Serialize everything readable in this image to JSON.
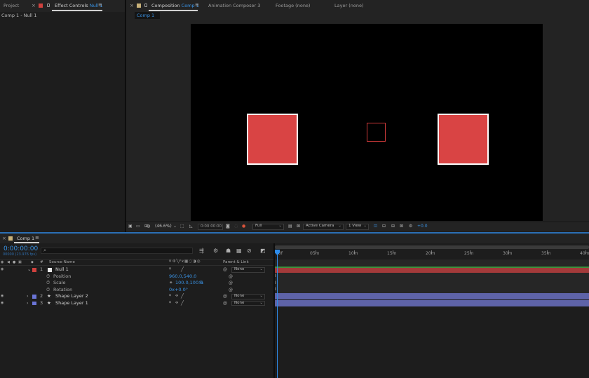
{
  "top_tabs": {
    "project": "Project",
    "effect_controls_prefix": "Effect Controls",
    "effect_controls_target": "Null 1",
    "composition_prefix": "Composition",
    "composition_target": "Comp 1",
    "animation_composer": "Animation Composer 3",
    "footage": "Footage (none)",
    "layer": "Layer (none)"
  },
  "effect_controls": {
    "breadcrumb": "Comp 1 - Null 1"
  },
  "composition": {
    "sub_tab": "Comp 1"
  },
  "viewer_toolbar": {
    "zoom": "(46.6%)",
    "timecode": "0:00:00:00",
    "resolution": "Full",
    "camera": "Active Camera",
    "view": "1 View",
    "exposure": "+0.0"
  },
  "timeline": {
    "tab": "Comp 1",
    "timecode": "0:00:00:00",
    "frame_info": "00000 (23.976 fps)",
    "search_placeholder": "",
    "headers": {
      "num": "#",
      "source_name": "Source Name",
      "parent_link": "Parent & Link"
    },
    "layers": [
      {
        "num": "1",
        "name": "Null 1",
        "label_color": "#d0413e",
        "parent": "None"
      },
      {
        "num": "2",
        "name": "Shape Layer 2",
        "label_color": "#6a74d6",
        "parent": "None"
      },
      {
        "num": "3",
        "name": "Shape Layer 1",
        "label_color": "#6a74d6",
        "parent": "None"
      }
    ],
    "properties": [
      {
        "name": "Position",
        "value": "960.0,540.0"
      },
      {
        "name": "Scale",
        "value": "100.0,100.0",
        "unit": "%"
      },
      {
        "name": "Rotation",
        "value": "0x+0.0°"
      }
    ],
    "ruler": [
      "0f",
      "05m",
      "10m",
      "15m",
      "20m",
      "25m",
      "30m",
      "35m",
      "40m"
    ]
  },
  "colors": {
    "accent": "#3a93e5",
    "shape_fill": "#d94444",
    "null_bar": "#a33a3a",
    "null_bar_top": "#3f8f3f",
    "shape_bar": "#5e63a8"
  }
}
